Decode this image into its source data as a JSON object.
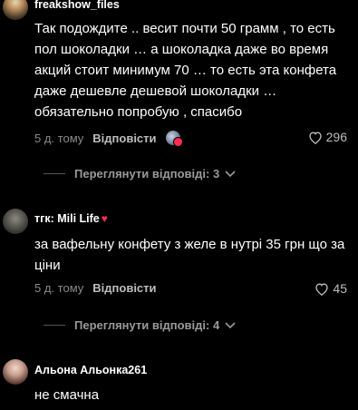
{
  "comments": [
    {
      "username": "freakshow_files",
      "text": "Так подождите .. весит почти 50 грамм , то есть пол шоколадки … а шоколадка даже во время акций стоит минимум 70 … то есть эта конфета даже дешевле дешевой шоколадки … обязательно попробую , спасибо",
      "time": "5 д. тому",
      "reply_label": "Відповісти",
      "likes": "296",
      "view_replies": "Переглянути відповіді: 3"
    },
    {
      "username": "тгк: Mili Life",
      "badge": "♥",
      "text": "за вафельну конфету з желе в нутрі 35 грн що за ціни",
      "time": "5 д. тому",
      "reply_label": "Відповісти",
      "likes": "45",
      "view_replies": "Переглянути відповіді: 4"
    },
    {
      "username": "Альона Альонка261",
      "text": "не смачна"
    }
  ],
  "colors": {
    "background": "#000000",
    "badge_red": "#ff2d55",
    "muted": "#8a8a8a"
  },
  "icons": [
    "heart-outline-icon",
    "chevron-down-icon",
    "avatar"
  ]
}
